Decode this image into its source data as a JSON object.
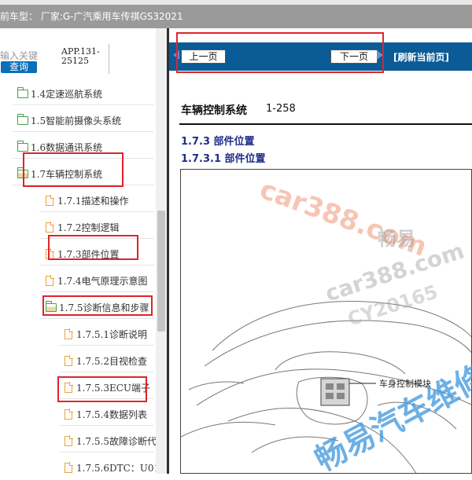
{
  "header": {
    "title": "前车型：  厂家:G-广汽乘用车传祺GS32021"
  },
  "sidebar": {
    "search_hint": "输入关键",
    "query_button": "查询",
    "app_code_1": "APP.131-",
    "app_code_2": "25125",
    "items": [
      {
        "label": "1.4定速巡航系统",
        "type": "folder"
      },
      {
        "label": "1.5智能前摄像头系统",
        "type": "folder"
      },
      {
        "label": "1.6数据通讯系统",
        "type": "folder"
      },
      {
        "label": "1.7车辆控制系统",
        "type": "folder-open"
      },
      {
        "label": "1.7.1描述和操作",
        "type": "doc"
      },
      {
        "label": "1.7.2控制逻辑",
        "type": "doc"
      },
      {
        "label": "1.7.3部件位置",
        "type": "doc"
      },
      {
        "label": "1.7.4电气原理示意图",
        "type": "doc"
      },
      {
        "label": "1.7.5诊断信息和步骤",
        "type": "folder-open"
      },
      {
        "label": "1.7.5.1诊断说明",
        "type": "doc"
      },
      {
        "label": "1.7.5.2目视检查",
        "type": "doc"
      },
      {
        "label": "1.7.5.3ECU端子",
        "type": "doc"
      },
      {
        "label": "1.7.5.4数据列表",
        "type": "doc"
      },
      {
        "label": "1.7.5.5故障诊断代",
        "type": "doc"
      },
      {
        "label": "1.7.5.6DTC：U01",
        "type": "doc"
      }
    ]
  },
  "nav": {
    "prev": "上一页",
    "next": "下一页",
    "refresh": "[刷新当前页]"
  },
  "document": {
    "title": "车辆控制系统",
    "page": "1-258",
    "section1": "1.7.3 部件位置",
    "section2": "1.7.3.1 部件位置",
    "callout": "车身控制模块"
  },
  "watermarks": [
    "car388.com",
    "畅易",
    "car388.com",
    "CY20165",
    "畅易汽车维修"
  ],
  "colors": {
    "navbar": "#0b5b96",
    "highlight": "#e0242b",
    "section_text": "#1f2e8a"
  }
}
